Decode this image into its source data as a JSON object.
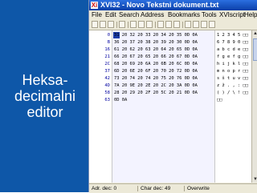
{
  "slide": {
    "caption_lines": [
      "Heksa-",
      "decimalni",
      "editor"
    ]
  },
  "window": {
    "icon_text": "Xi",
    "title": "XVI32 - Novo Tekstni dokument.txt"
  },
  "menu": [
    "File",
    "Edit",
    "Search",
    "Address",
    "Bookmarks",
    "Tools",
    "XVIscript",
    "Help"
  ],
  "editor": {
    "rows": [
      {
        "offset": "0",
        "hex": "31 20 32 20 33 20 34 20 35 0D 0A",
        "ascii": "1 2 3 4 5 □□"
      },
      {
        "offset": "B",
        "hex": "36 20 37 20 38 20 39 20 30 0D 0A",
        "ascii": "6 7 8 9 0 □□"
      },
      {
        "offset": "16",
        "hex": "61 20 62 20 63 20 64 20 65 0D 0A",
        "ascii": "a b c d e □□"
      },
      {
        "offset": "21",
        "hex": "66 20 67 20 65 20 66 20 67 0D 0A",
        "ascii": "f g e f g □□"
      },
      {
        "offset": "2C",
        "hex": "68 20 69 20 6A 20 6B 20 6C 0D 0A",
        "ascii": "h i j k l □□"
      },
      {
        "offset": "37",
        "hex": "6D 20 6E 20 6F 20 70 20 72 0D 0A",
        "ascii": "m n o p r □□"
      },
      {
        "offset": "42",
        "hex": "73 20 74 20 74 20 75 20 76 0D 0A",
        "ascii": "s š t u v □□"
      },
      {
        "offset": "4D",
        "hex": "7A 20 9E 20 2E 20 2C 20 3A 0D 0A",
        "ascii": "z ž . , : □□"
      },
      {
        "offset": "58",
        "hex": "28 20 29 20 2F 20 5C 20 21 0D 0A",
        "ascii": "( ) / \\ ! □□"
      },
      {
        "offset": "63",
        "hex": "0D 0A",
        "ascii": "□□"
      }
    ]
  },
  "status": {
    "address": "Adr. dec: 0",
    "char": "Char dec: 49",
    "mode": "Overwrite"
  }
}
